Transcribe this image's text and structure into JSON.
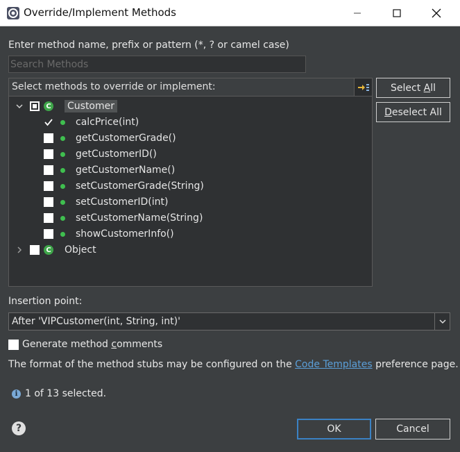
{
  "window": {
    "title": "Override/Implement Methods",
    "app_icon": "eclipse-icon"
  },
  "search": {
    "label": "Enter method name, prefix or pattern (*, ? or camel case)",
    "placeholder": "Search Methods",
    "value": ""
  },
  "tree": {
    "header": "Select methods to override or implement:",
    "sort_icon": "sort-members-icon",
    "classes": [
      {
        "name": "Customer",
        "expanded": true,
        "check_state": "partial",
        "methods": [
          {
            "label": "calcPrice(int)",
            "checked": true
          },
          {
            "label": "getCustomerGrade()",
            "checked": false
          },
          {
            "label": "getCustomerID()",
            "checked": false
          },
          {
            "label": "getCustomerName()",
            "checked": false
          },
          {
            "label": "setCustomerGrade(String)",
            "checked": false
          },
          {
            "label": "setCustomerID(int)",
            "checked": false
          },
          {
            "label": "setCustomerName(String)",
            "checked": false
          },
          {
            "label": "showCustomerInfo()",
            "checked": false
          }
        ]
      },
      {
        "name": "Object",
        "expanded": false,
        "check_state": "unchecked",
        "methods": []
      }
    ]
  },
  "buttons": {
    "select_all_pre": "Select ",
    "select_all_mn": "A",
    "select_all_post": "ll",
    "deselect_all_mn": "D",
    "deselect_all_post": "eselect All",
    "ok": "OK",
    "cancel": "Cancel"
  },
  "insertion": {
    "label": "Insertion point:",
    "value": "After 'VIPCustomer(int, String, int)'"
  },
  "generate_comments": {
    "pre": "Generate method ",
    "mn": "c",
    "post": "omments",
    "checked": false
  },
  "format_note": {
    "pre": "The format of the method stubs may be configured on the ",
    "link": "Code Templates",
    "post": " preference page."
  },
  "status": {
    "text": "1 of 13 selected."
  },
  "colors": {
    "background": "#3c3f41",
    "tree_background": "#2f3133",
    "link": "#5b9fd9",
    "method_dot": "#3fbf4f",
    "class_icon": "#3fa64a",
    "default_button_border": "#3b82c4"
  }
}
